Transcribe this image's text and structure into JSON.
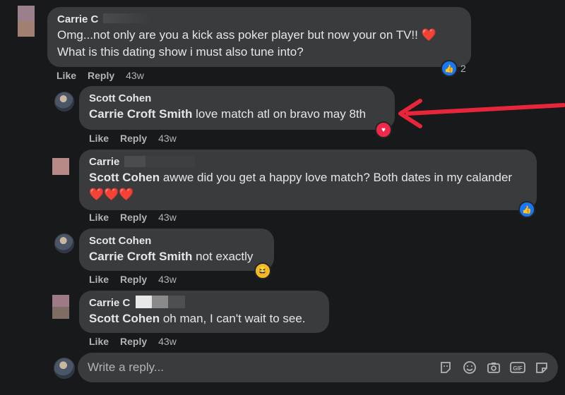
{
  "actions": {
    "like": "Like",
    "reply": "Reply"
  },
  "comments": [
    {
      "name": "Carrie C",
      "text": "Omg...not only are you a kick ass poker player but now your on TV!! ❤️ What is this dating show i must also tune into?",
      "time": "43w",
      "reaction_count": "2"
    },
    {
      "name": "Scott Cohen",
      "tag": "Carrie Croft Smith",
      "text": " love match atl on bravo may 8th",
      "time": "43w"
    },
    {
      "name": "Carrie",
      "tag": "Scott Cohen",
      "text": " awwe did you get a happy love match? Both dates in my calander ❤️❤️❤️",
      "time": "43w"
    },
    {
      "name": "Scott Cohen",
      "tag": "Carrie Croft Smith",
      "text": " not exactly",
      "time": "43w"
    },
    {
      "name": "Carrie C",
      "tag": "Scott Cohen",
      "text": " oh man, I can't wait to see.",
      "time": "43w"
    }
  ],
  "composer": {
    "placeholder": "Write a reply..."
  },
  "icons": [
    "sticker-icon",
    "emoji-icon",
    "camera-icon",
    "gif-icon",
    "avatar-sticker-icon"
  ],
  "colors": {
    "background": "#18191a",
    "bubble": "#3a3b3c",
    "like_blue": "#1877f2",
    "love_red": "#f02849",
    "annotation_arrow": "#e8263b"
  }
}
